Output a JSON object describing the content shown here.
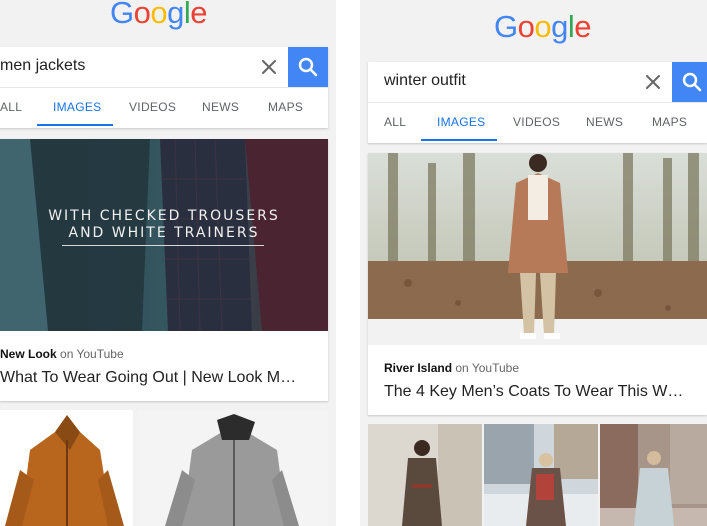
{
  "left": {
    "logo": [
      "G",
      "o",
      "o",
      "g",
      "l",
      "e"
    ],
    "search": {
      "query": "men jackets"
    },
    "tabs": [
      "ALL",
      "IMAGES",
      "VIDEOS",
      "NEWS",
      "MAPS"
    ],
    "active_tab": "IMAGES",
    "result": {
      "overlay_line1": "WITH CHECKED TROUSERS",
      "overlay_line2": "AND WHITE TRAINERS",
      "source_name": "New Look",
      "source_suffix": "on YouTube",
      "title": "What To Wear Going Out | New Look Me..."
    }
  },
  "right": {
    "logo": [
      "G",
      "o",
      "o",
      "g",
      "l",
      "e"
    ],
    "search": {
      "query": "winter outfit"
    },
    "tabs": [
      "ALL",
      "IMAGES",
      "VIDEOS",
      "NEWS",
      "MAPS"
    ],
    "active_tab": "IMAGES",
    "result": {
      "source_name": "River Island",
      "source_suffix": "on YouTube",
      "title": "The 4 Key Men’s Coats To Wear This Wi..."
    }
  },
  "colors": {
    "google_blue": "#4285F4",
    "google_red": "#EA4335",
    "google_yellow": "#FBBC05",
    "google_green": "#34A853",
    "active_tab": "#1A73E8"
  },
  "icons": [
    "clear-icon",
    "search-icon"
  ]
}
